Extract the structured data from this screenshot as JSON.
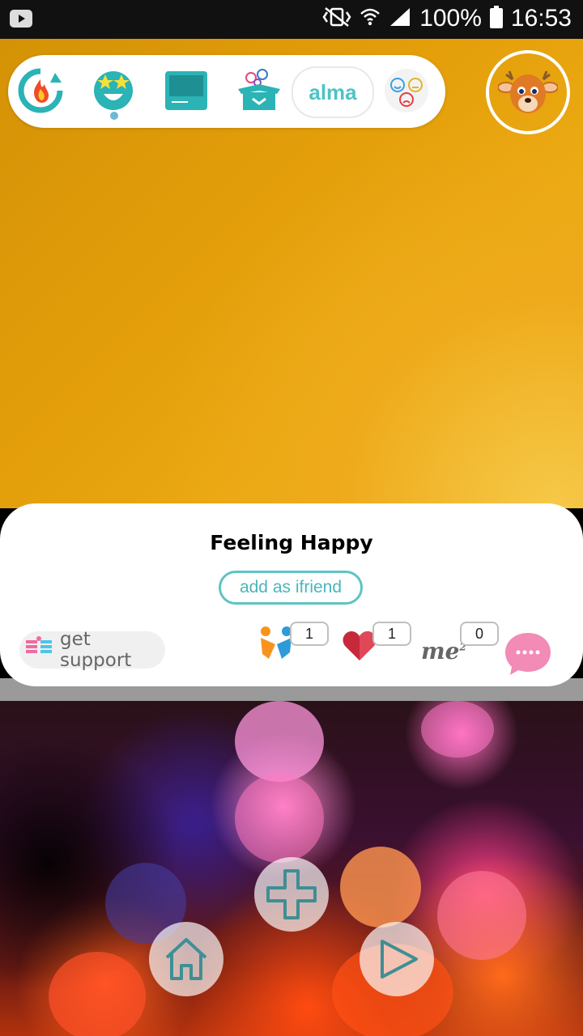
{
  "status_bar": {
    "battery": "100%",
    "time": "16:53",
    "icons": [
      "youtube-notification-icon",
      "vibrate-mute-icon",
      "wifi-icon",
      "signal-icon",
      "battery-icon"
    ]
  },
  "nav": {
    "items": [
      {
        "name": "streak-icon"
      },
      {
        "name": "star-face-icon",
        "active": true
      },
      {
        "name": "screen-icon"
      },
      {
        "name": "mood-box-icon"
      },
      {
        "name": "alma-button",
        "label": "alma"
      },
      {
        "name": "moods-icon"
      }
    ]
  },
  "profile": {
    "avatar": "deer-avatar-icon"
  },
  "card": {
    "title": "Feeling Happy",
    "add_friend_label": "add as ifriend",
    "support_label": "get support",
    "reactions": [
      {
        "name": "hug",
        "count": "1"
      },
      {
        "name": "heart",
        "count": "1"
      },
      {
        "name": "me2",
        "label": "me",
        "sup": "2",
        "count": "0"
      }
    ]
  },
  "colors": {
    "accent_teal": "#4fc3c4",
    "hero_orange": "#e39e0a",
    "chat_pink": "#f28bb6",
    "heart_red": "#c8283c"
  },
  "bottom_nav": {
    "add_icon": "plus-icon",
    "home_icon": "home-icon",
    "next_icon": "play-arrow-icon"
  }
}
